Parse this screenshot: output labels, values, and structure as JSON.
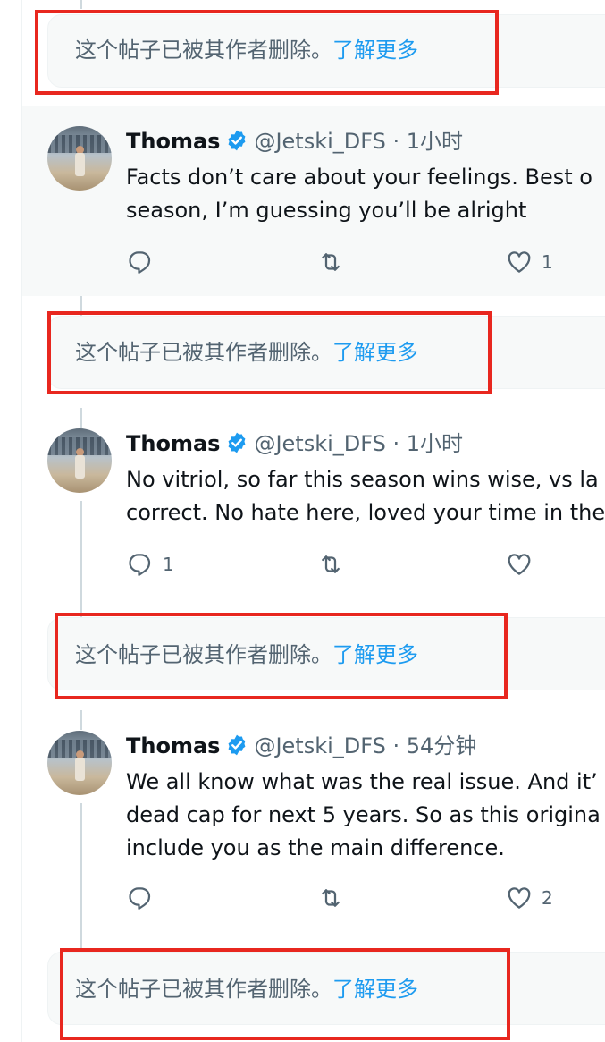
{
  "deleted_notice": {
    "text": "这个帖子已被其作者删除。",
    "link": "了解更多"
  },
  "tweets": [
    {
      "name": "Thomas",
      "handle": "@Jetski_DFS",
      "separator": "·",
      "time": "1小时",
      "lines": [
        "Facts don’t care about your feelings.  Best o",
        "season, I’m guessing you’ll be alright"
      ],
      "reply_count": "",
      "like_count": "1"
    },
    {
      "name": "Thomas",
      "handle": "@Jetski_DFS",
      "separator": "·",
      "time": "1小时",
      "lines": [
        "No vitriol, so far this season wins wise, vs la",
        "correct. No hate here, loved your time in the"
      ],
      "reply_count": "1",
      "like_count": ""
    },
    {
      "name": "Thomas",
      "handle": "@Jetski_DFS",
      "separator": "·",
      "time": "54分钟",
      "lines": [
        "We all know what was the real issue. And it’",
        "dead cap for next 5 years. So as this origina",
        "include you as the main difference."
      ],
      "reply_count": "",
      "like_count": "2"
    }
  ],
  "colors": {
    "accent": "#1d9bf0",
    "muted": "#536471",
    "highlight_frame": "#e8271f",
    "thread_line": "#cfd9de"
  },
  "icons": [
    "verified-badge-icon",
    "reply-icon",
    "retweet-icon",
    "like-icon"
  ]
}
